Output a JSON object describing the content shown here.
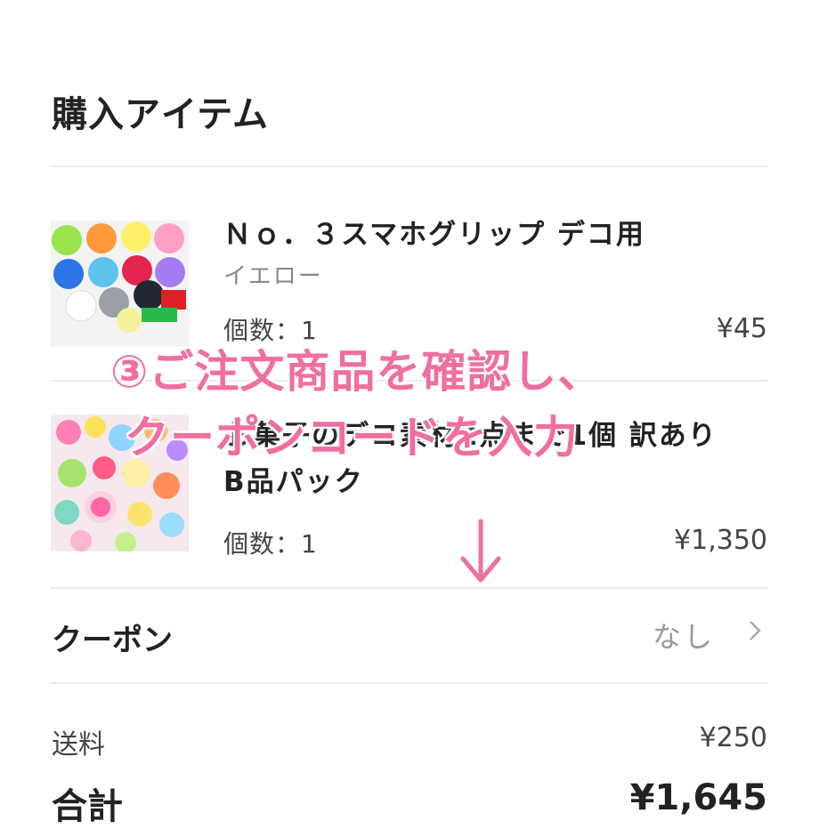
{
  "section": {
    "title": "購入アイテム"
  },
  "items": [
    {
      "name": "Ｎｏ．３スマホグリップ デコ用",
      "variant": "イエロー",
      "quantity": "個数：1",
      "price": "¥45"
    },
    {
      "name_line1": "お菓子のデコ素材2点まで1個 訳あり",
      "name_line2": "B品パック",
      "quantity": "個数：1",
      "price": "¥1,350"
    }
  ],
  "coupon": {
    "label": "クーポン",
    "value": "なし"
  },
  "shipping": {
    "label": "送料",
    "value": "¥250"
  },
  "total": {
    "label": "合計",
    "value": "¥1,645"
  },
  "overlay": {
    "line1": "③ご注文商品を確認し、",
    "line2": "クーポンコードを入力",
    "color": "#f06ea1"
  },
  "icons": [
    "product-thumbnail-grips",
    "product-thumbnail-sweets",
    "chevron-right-icon",
    "down-arrow-icon"
  ]
}
